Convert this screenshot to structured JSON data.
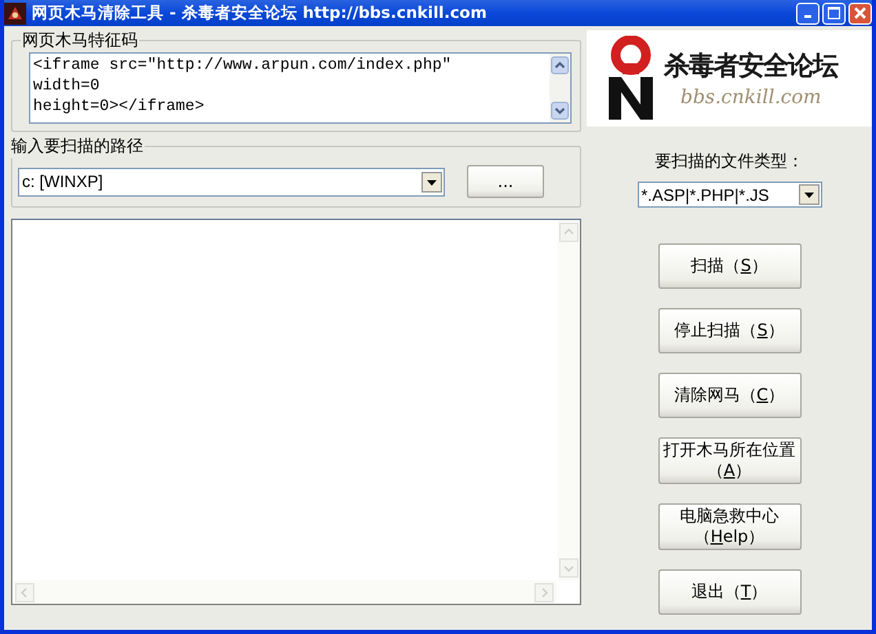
{
  "window": {
    "title": "网页木马清除工具 - 杀毒者安全论坛 http://bbs.cnkill.com"
  },
  "signature_group": {
    "label": "网页木马特征码",
    "value": [
      "<iframe src=\"http://www.arpun.com/index.php\"",
      "width=0",
      "height=0></iframe>"
    ]
  },
  "path_group": {
    "label": "输入要扫描的路径",
    "path": "c: [WINXP]",
    "browse_button": "..."
  },
  "logo": {
    "title": "杀毒者安全论坛",
    "subtitle": "bbs.cnkill.com"
  },
  "file_type": {
    "label": "要扫描的文件类型：",
    "value": "*.ASP|*.PHP|*.JS"
  },
  "buttons": [
    {
      "before": "扫描（",
      "key": "S",
      "after": "）"
    },
    {
      "before": "停止扫描（",
      "key": "S",
      "after": "）"
    },
    {
      "before": "清除网马（",
      "key": "C",
      "after": "）"
    },
    {
      "before": "打开木马所在位置（",
      "key": "A",
      "after": "）"
    },
    {
      "before": "电脑急救中心（",
      "key": "H",
      "after": "elp）"
    },
    {
      "before": "退出（",
      "key": "T",
      "after": "）"
    }
  ]
}
